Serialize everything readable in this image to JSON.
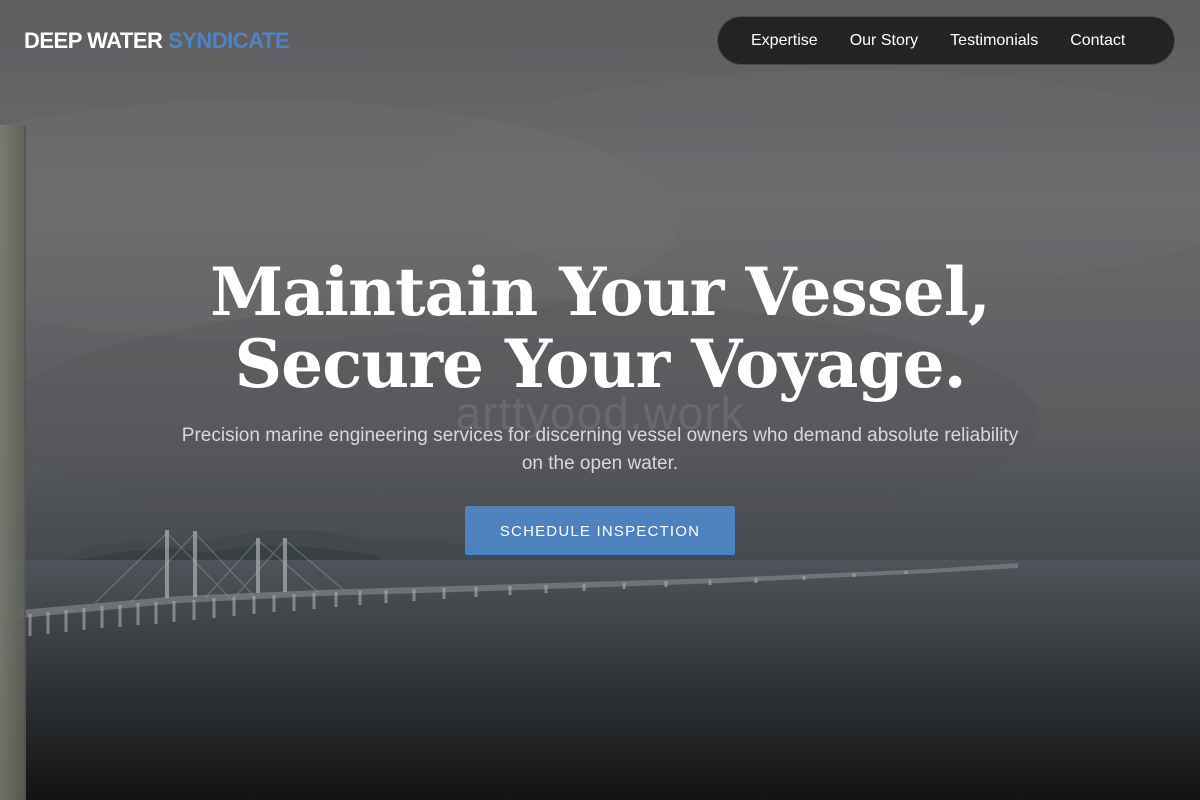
{
  "header": {
    "logo_primary": "DEEP WATER",
    "logo_accent": "SYNDICATE",
    "nav_links": [
      {
        "label": "Expertise"
      },
      {
        "label": "Our Story"
      },
      {
        "label": "Testimonials"
      },
      {
        "label": "Contact"
      }
    ]
  },
  "hero": {
    "headline_line1": "Maintain Your Vessel,",
    "headline_line2": "Secure Your Voyage.",
    "subheadline": "Precision marine engineering services for discerning vessel owners who demand absolute reliability on the open water.",
    "cta_label": "SCHEDULE INSPECTION",
    "watermark_text": "arttyood.work"
  },
  "colors": {
    "logo_accent": "#4f84c2",
    "cta_background": "#4c82bd",
    "nav_background": "#1f1f1f"
  }
}
